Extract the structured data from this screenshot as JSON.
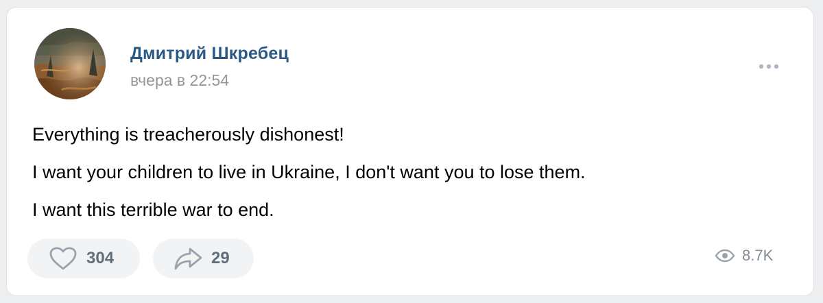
{
  "post": {
    "author": "Дмитрий Шкребец",
    "timestamp": "вчера в 22:54",
    "text_lines": [
      "Everything is treacherously dishonest!",
      "I want your children to live in Ukraine, I don't want you to lose them.",
      "I want this terrible war to end."
    ]
  },
  "actions": {
    "likes": "304",
    "shares": "29",
    "views": "8.7K"
  },
  "icons": {
    "more": "more-horizontal-icon",
    "like": "heart-outline-icon",
    "share": "share-arrow-icon",
    "views": "eye-icon"
  },
  "colors": {
    "author_link": "#2a5885",
    "meta_gray": "#939699",
    "action_gray": "#99a2ad",
    "pill_bg": "#f2f3f5",
    "page_bg": "#edeef0"
  }
}
